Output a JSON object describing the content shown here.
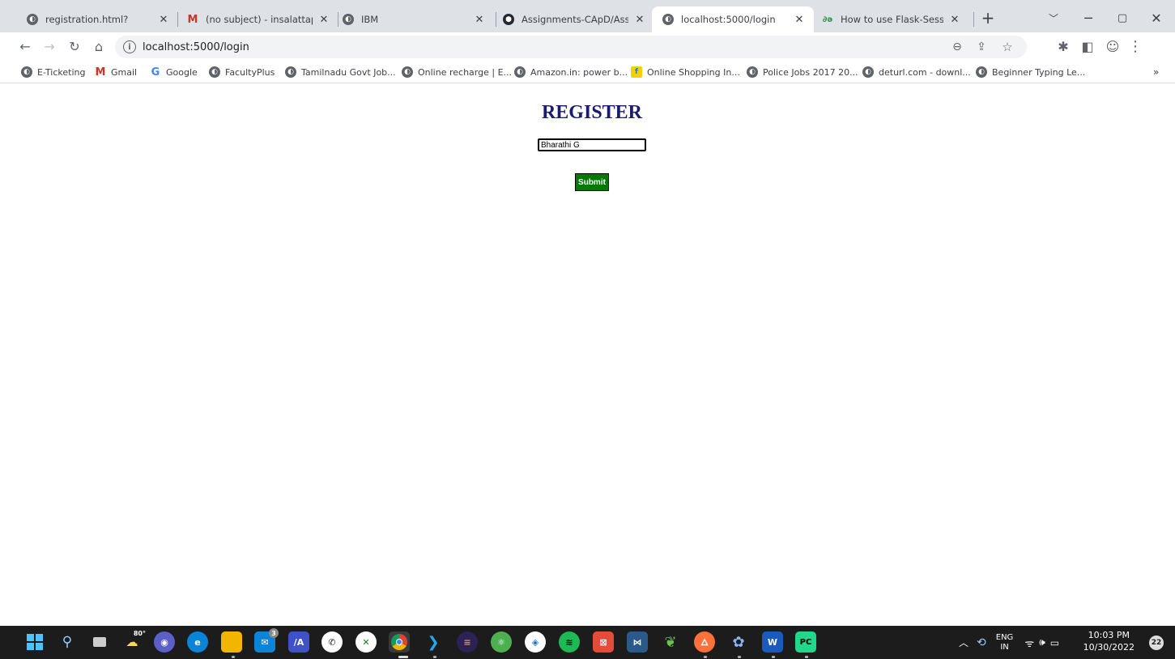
{
  "tabs": [
    {
      "title": "registration.html?",
      "icon": "globe-icon"
    },
    {
      "title": "(no subject) - insalattapriya",
      "icon": "gmail-icon"
    },
    {
      "title": "IBM",
      "icon": "globe-icon"
    },
    {
      "title": "Assignments-CApD/Assignm",
      "icon": "github-icon"
    },
    {
      "title": "localhost:5000/login",
      "icon": "globe-icon",
      "active": true
    },
    {
      "title": "How to use Flask-Session in",
      "icon": "geeksforgeeks-icon"
    }
  ],
  "toolbar": {
    "url": "localhost:5000/login"
  },
  "bookmarks": [
    {
      "label": "E-Ticketing",
      "icon": "globe-icon"
    },
    {
      "label": "Gmail",
      "icon": "gmail-icon"
    },
    {
      "label": "Google",
      "icon": "google-icon"
    },
    {
      "label": "FacultyPlus",
      "icon": "globe-icon"
    },
    {
      "label": "Tamilnadu Govt Job...",
      "icon": "globe-icon"
    },
    {
      "label": "Online recharge | E...",
      "icon": "globe-icon"
    },
    {
      "label": "Amazon.in: power b...",
      "icon": "globe-icon"
    },
    {
      "label": "Online Shopping In...",
      "icon": "flipkart-icon"
    },
    {
      "label": "Police Jobs 2017 20...",
      "icon": "globe-icon"
    },
    {
      "label": "deturl.com - downl...",
      "icon": "globe-icon"
    },
    {
      "label": "Beginner Typing Le...",
      "icon": "globe-icon"
    }
  ],
  "page": {
    "heading": "REGISTER",
    "name_value": "Bharathi G",
    "submit_label": "Submit"
  },
  "taskbar": {
    "weather_temp": "80°",
    "mail_badge": "3",
    "language": "ENG",
    "region": "IN",
    "time": "10:03 PM",
    "date": "10/30/2022",
    "notification_count": "22"
  },
  "colors": {
    "heading": "#1a1a6e",
    "submit_bg": "#007a00",
    "tabstrip_bg": "#dee1e6",
    "taskbar_bg": "#1c1c1c"
  }
}
